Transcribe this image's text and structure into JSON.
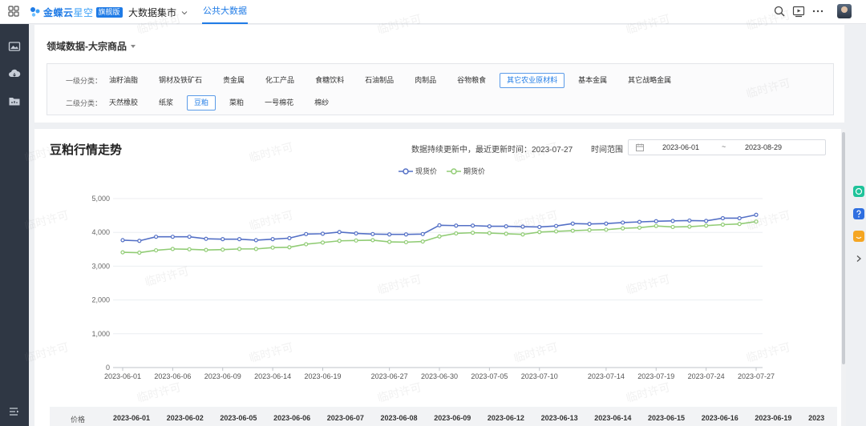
{
  "topbar": {
    "brand_main": "金蝶云",
    "brand_light": "星空",
    "brand_badge": "旗舰版",
    "nav_market": "大数据集市",
    "nav_public": "公共大数据"
  },
  "filters": {
    "domain_title": "领域数据-大宗商品",
    "level1_label": "一级分类：",
    "level1": [
      "油籽油脂",
      "钢材及铁矿石",
      "贵金属",
      "化工产品",
      "食糖饮料",
      "石油制品",
      "肉制品",
      "谷物粮食",
      "其它农业原材料",
      "基本金属",
      "其它战略金属"
    ],
    "level1_selected": "其它农业原材料",
    "level2_label": "二级分类：",
    "level2": [
      "天然橡胶",
      "纸浆",
      "豆粕",
      "菜粕",
      "一号棉花",
      "棉纱"
    ],
    "level2_selected": "豆粕"
  },
  "chart_header": {
    "title": "豆粕行情走势",
    "update_note": "数据持续更新中，最近更新时间：2023-07-27",
    "range_label": "时间范围",
    "range_start": "2023-06-01",
    "range_sep": "~",
    "range_end": "2023-08-29"
  },
  "chart_data": {
    "type": "line",
    "x": [
      "2023-06-01",
      "2023-06-02",
      "2023-06-05",
      "2023-06-06",
      "2023-06-07",
      "2023-06-08",
      "2023-06-09",
      "2023-06-12",
      "2023-06-13",
      "2023-06-14",
      "2023-06-15",
      "2023-06-16",
      "2023-06-19",
      "2023-06-20",
      "2023-06-21",
      "2023-06-26",
      "2023-06-27",
      "2023-06-28",
      "2023-06-29",
      "2023-06-30",
      "2023-07-03",
      "2023-07-04",
      "2023-07-05",
      "2023-07-06",
      "2023-07-07",
      "2023-07-10",
      "2023-07-11",
      "2023-07-12",
      "2023-07-13",
      "2023-07-14",
      "2023-07-17",
      "2023-07-18",
      "2023-07-19",
      "2023-07-20",
      "2023-07-21",
      "2023-07-24",
      "2023-07-25",
      "2023-07-26",
      "2023-07-27"
    ],
    "x_ticks": [
      "2023-06-01",
      "2023-06-06",
      "2023-06-09",
      "2023-06-14",
      "2023-06-19",
      "2023-06-27",
      "2023-06-30",
      "2023-07-05",
      "2023-07-10",
      "2023-07-14",
      "2023-07-19",
      "2023-07-24",
      "2023-07-27"
    ],
    "series": [
      {
        "name": "现货价",
        "color": "#5470c6",
        "values": [
          3770,
          3750,
          3870,
          3870,
          3870,
          3810,
          3800,
          3800,
          3770,
          3800,
          3830,
          3950,
          3960,
          4010,
          3970,
          3950,
          3940,
          3940,
          3950,
          4210,
          4200,
          4200,
          4180,
          4180,
          4170,
          4160,
          4190,
          4260,
          4250,
          4260,
          4290,
          4310,
          4330,
          4340,
          4350,
          4340,
          4420,
          4420,
          4520
        ]
      },
      {
        "name": "期货价",
        "color": "#91cc75",
        "values": [
          3410,
          3400,
          3470,
          3510,
          3500,
          3480,
          3490,
          3510,
          3510,
          3550,
          3560,
          3650,
          3700,
          3750,
          3760,
          3770,
          3720,
          3710,
          3730,
          3880,
          3970,
          3990,
          3980,
          3960,
          3940,
          4010,
          4030,
          4050,
          4070,
          4080,
          4120,
          4140,
          4190,
          4160,
          4170,
          4200,
          4230,
          4250,
          4320
        ]
      }
    ],
    "y_ticks": [
      "0",
      "1,000",
      "2,000",
      "3,000",
      "4,000",
      "5,000"
    ],
    "ylim": [
      0,
      5000
    ],
    "legend_position": "top-center",
    "grid": true
  },
  "table": {
    "header_label": "价格",
    "dates": [
      "2023-06-01",
      "2023-06-02",
      "2023-06-05",
      "2023-06-06",
      "2023-06-07",
      "2023-06-08",
      "2023-06-09",
      "2023-06-12",
      "2023-06-13",
      "2023-06-14",
      "2023-06-15",
      "2023-06-16",
      "2023-06-19",
      "2023"
    ]
  },
  "watermark_text": "临时许可"
}
